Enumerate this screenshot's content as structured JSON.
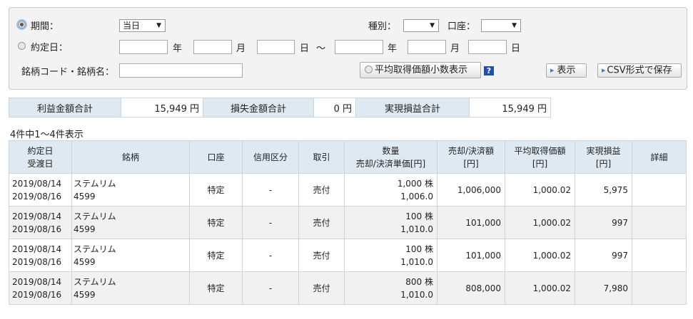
{
  "filter": {
    "period_label": "期間：",
    "period_value": "当日",
    "type_label": "種別：",
    "type_value": "",
    "account_label": "口座：",
    "account_value": "",
    "date_label": "約定日：",
    "year": "年",
    "month": "月",
    "day": "日",
    "tilde": "～",
    "symbol_label": "銘柄コード・銘柄名：",
    "decimal_toggle": "平均取得価額小数表示",
    "help": "?",
    "show_button": "表示",
    "csv_button": "CSV形式で保存"
  },
  "summary": {
    "profit_label": "利益金額合計",
    "profit_value": "15,949 円",
    "loss_label": "損失金額合計",
    "loss_value": "0 円",
    "realized_label": "実現損益合計",
    "realized_value": "15,949 円"
  },
  "count_text": "4件中1～4件表示",
  "table": {
    "headers": {
      "date1": "約定日",
      "date2": "受渡日",
      "symbol": "銘柄",
      "account": "口座",
      "credit": "信用区分",
      "trade": "取引",
      "qty1": "数量",
      "qty2": "売却/決済単価[円]",
      "amount1": "売却/決済額",
      "amount2": "[円]",
      "avg1": "平均取得価額",
      "avg2": "[円]",
      "pl1": "実現損益",
      "pl2": "[円]",
      "detail": "詳細"
    },
    "rows": [
      {
        "trade_date": "2019/08/14",
        "settle_date": "2019/08/16",
        "name": "ステムリム",
        "code": "4599",
        "account": "特定",
        "credit": "-",
        "trade": "売付",
        "qty": "1,000 株",
        "price": "1,006.0",
        "amount": "1,006,000",
        "avg": "1,000.02",
        "pl": "5,975"
      },
      {
        "trade_date": "2019/08/14",
        "settle_date": "2019/08/16",
        "name": "ステムリム",
        "code": "4599",
        "account": "特定",
        "credit": "-",
        "trade": "売付",
        "qty": "100 株",
        "price": "1,010.0",
        "amount": "101,000",
        "avg": "1,000.02",
        "pl": "997"
      },
      {
        "trade_date": "2019/08/14",
        "settle_date": "2019/08/16",
        "name": "ステムリム",
        "code": "4599",
        "account": "特定",
        "credit": "-",
        "trade": "売付",
        "qty": "100 株",
        "price": "1,010.0",
        "amount": "101,000",
        "avg": "1,000.02",
        "pl": "997"
      },
      {
        "trade_date": "2019/08/14",
        "settle_date": "2019/08/16",
        "name": "ステムリム",
        "code": "4599",
        "account": "特定",
        "credit": "-",
        "trade": "売付",
        "qty": "800 株",
        "price": "1,010.0",
        "amount": "808,000",
        "avg": "1,000.02",
        "pl": "7,980"
      }
    ]
  }
}
